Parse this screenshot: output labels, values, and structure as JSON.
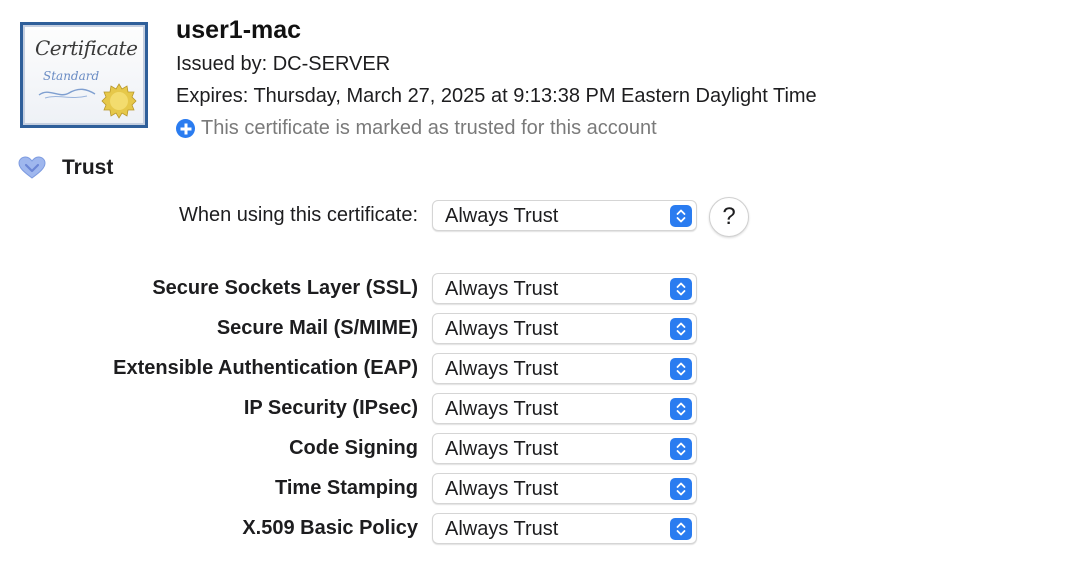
{
  "header": {
    "cert_icon_word": "Certificate",
    "cert_icon_sub": "Standard",
    "title": "user1-mac",
    "issued_by": "Issued by: DC-SERVER",
    "expires": "Expires: Thursday, March 27, 2025 at 9:13:38 PM Eastern Daylight Time",
    "trusted_note": "This certificate is marked as trusted for this account",
    "accent_color": "#2a7cf0"
  },
  "trust": {
    "section_label": "Trust",
    "when_using_label": "When using this certificate:",
    "when_using_value": "Always Trust",
    "help_label": "?",
    "policies": [
      {
        "label": "Secure Sockets Layer (SSL)",
        "value": "Always Trust"
      },
      {
        "label": "Secure Mail (S/MIME)",
        "value": "Always Trust"
      },
      {
        "label": "Extensible Authentication (EAP)",
        "value": "Always Trust"
      },
      {
        "label": "IP Security (IPsec)",
        "value": "Always Trust"
      },
      {
        "label": "Code Signing",
        "value": "Always Trust"
      },
      {
        "label": "Time Stamping",
        "value": "Always Trust"
      },
      {
        "label": "X.509 Basic Policy",
        "value": "Always Trust"
      }
    ]
  }
}
